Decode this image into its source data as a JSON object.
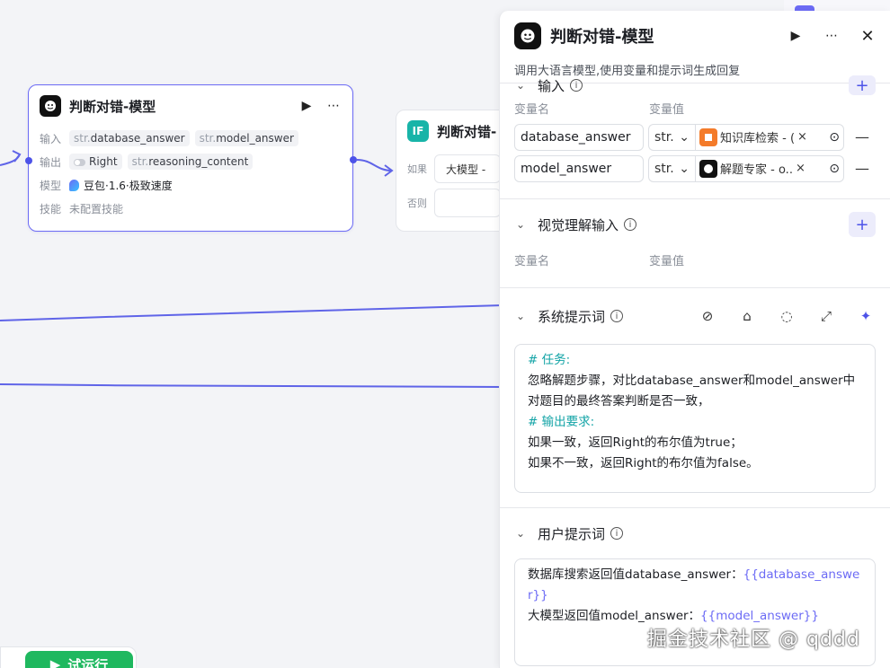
{
  "node_main": {
    "title": "判断对错-模型",
    "input_label": "输入",
    "inputs": [
      {
        "type": "str.",
        "name": "database_answer"
      },
      {
        "type": "str.",
        "name": "model_answer"
      }
    ],
    "output_label": "输出",
    "outputs": [
      {
        "type": "",
        "name": "Right"
      },
      {
        "type": "str.",
        "name": "reasoning_content"
      }
    ],
    "model_label": "模型",
    "model_value": "豆包·1.6·极致速度",
    "skill_label": "技能",
    "skill_value": "未配置技能"
  },
  "node_if": {
    "title": "判断对错-",
    "if_label": "如果",
    "if_value": "大模型 -",
    "else_label": "否则"
  },
  "run_button": {
    "label": "试运行"
  },
  "panel": {
    "title": "判断对错-模型",
    "description": "调用大语言模型,使用变量和提示词生成回复",
    "input_section": {
      "title": "输入",
      "col_name": "变量名",
      "col_value": "变量值",
      "rows": [
        {
          "name": "database_answer",
          "type": "str.",
          "ref": "知识库检索 - (",
          "ref_color": "#f47b2a"
        },
        {
          "name": "model_answer",
          "type": "str.",
          "ref": "解题专家 - o..",
          "ref_color": "#111111"
        }
      ]
    },
    "vision_section": {
      "title": "视觉理解输入",
      "col_name": "变量名",
      "col_value": "变量值"
    },
    "system_prompt": {
      "title": "系统提示词",
      "lines": [
        {
          "text": "# 任务:",
          "style": "hl"
        },
        {
          "text": "忽略解题步骤，对比database_answer和model_answer中对题目的最终答案判断是否一致，",
          "style": ""
        },
        {
          "text": "# 输出要求:",
          "style": "hl"
        },
        {
          "text": "如果一致，返回Right的布尔值为true；",
          "style": ""
        },
        {
          "text": "如果不一致，返回Right的布尔值为false。",
          "style": ""
        }
      ]
    },
    "user_prompt": {
      "title": "用户提示词",
      "line1_text": "数据库搜索返回值database_answer：",
      "line1_var": "{{database_answer}}",
      "line2_text": "大模型返回值model_answer：",
      "line2_var": "{{model_answer}}"
    }
  },
  "watermark": "掘金技术社区 @ qddd",
  "colors": {
    "accent": "#4d53e8",
    "run": "#1fb85f",
    "highlight": "#11a3a6"
  }
}
